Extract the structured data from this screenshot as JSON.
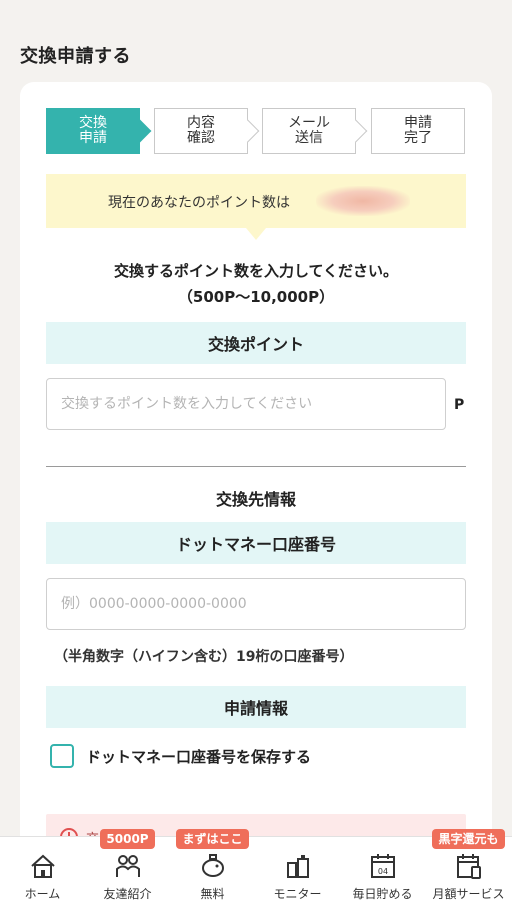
{
  "page": {
    "title": "交換申請する"
  },
  "steps": [
    {
      "label": "交換\n申請",
      "active": true
    },
    {
      "label": "内容\n確認",
      "active": false
    },
    {
      "label": "メール\n送信",
      "active": false
    },
    {
      "label": "申請\n完了",
      "active": false
    }
  ],
  "points_banner": {
    "text": "現在のあなたのポイント数は"
  },
  "instruction": {
    "line1": "交換するポイント数を入力してください。",
    "line2": "（500P〜10,000P）"
  },
  "exchange_points": {
    "heading": "交換ポイント",
    "placeholder": "交換するポイント数を入力してください",
    "unit": "P"
  },
  "destination": {
    "heading": "交換先情報",
    "account_heading": "ドットマネー口座番号",
    "placeholder": "例）0000-0000-0000-0000",
    "hint": "（半角数字（ハイフン含む）19桁の口座番号）"
  },
  "application": {
    "heading": "申請情報",
    "save_label": "ドットマネー口座番号を保存する"
  },
  "alert": {
    "text": "交　　　　　　　　　　　　　　　　　　　　"
  },
  "bottom_nav": {
    "items": [
      {
        "label": "ホーム",
        "icon": "home-icon",
        "badge": ""
      },
      {
        "label": "友達紹介",
        "icon": "friends-icon",
        "badge": "5000P"
      },
      {
        "label": "無料",
        "icon": "piggy-bank-icon",
        "badge": "まずはここ"
      },
      {
        "label": "モニター",
        "icon": "monitor-icon",
        "badge": ""
      },
      {
        "label": "毎日貯める",
        "icon": "calendar-icon",
        "badge": ""
      },
      {
        "label": "月額サービス",
        "icon": "monthly-service-icon",
        "badge": "黒字還元も"
      }
    ]
  },
  "colors": {
    "accent": "#34b3ad",
    "band": "#e3f6f6",
    "banner": "#fdf7cc",
    "badge": "#ef6e5a"
  }
}
